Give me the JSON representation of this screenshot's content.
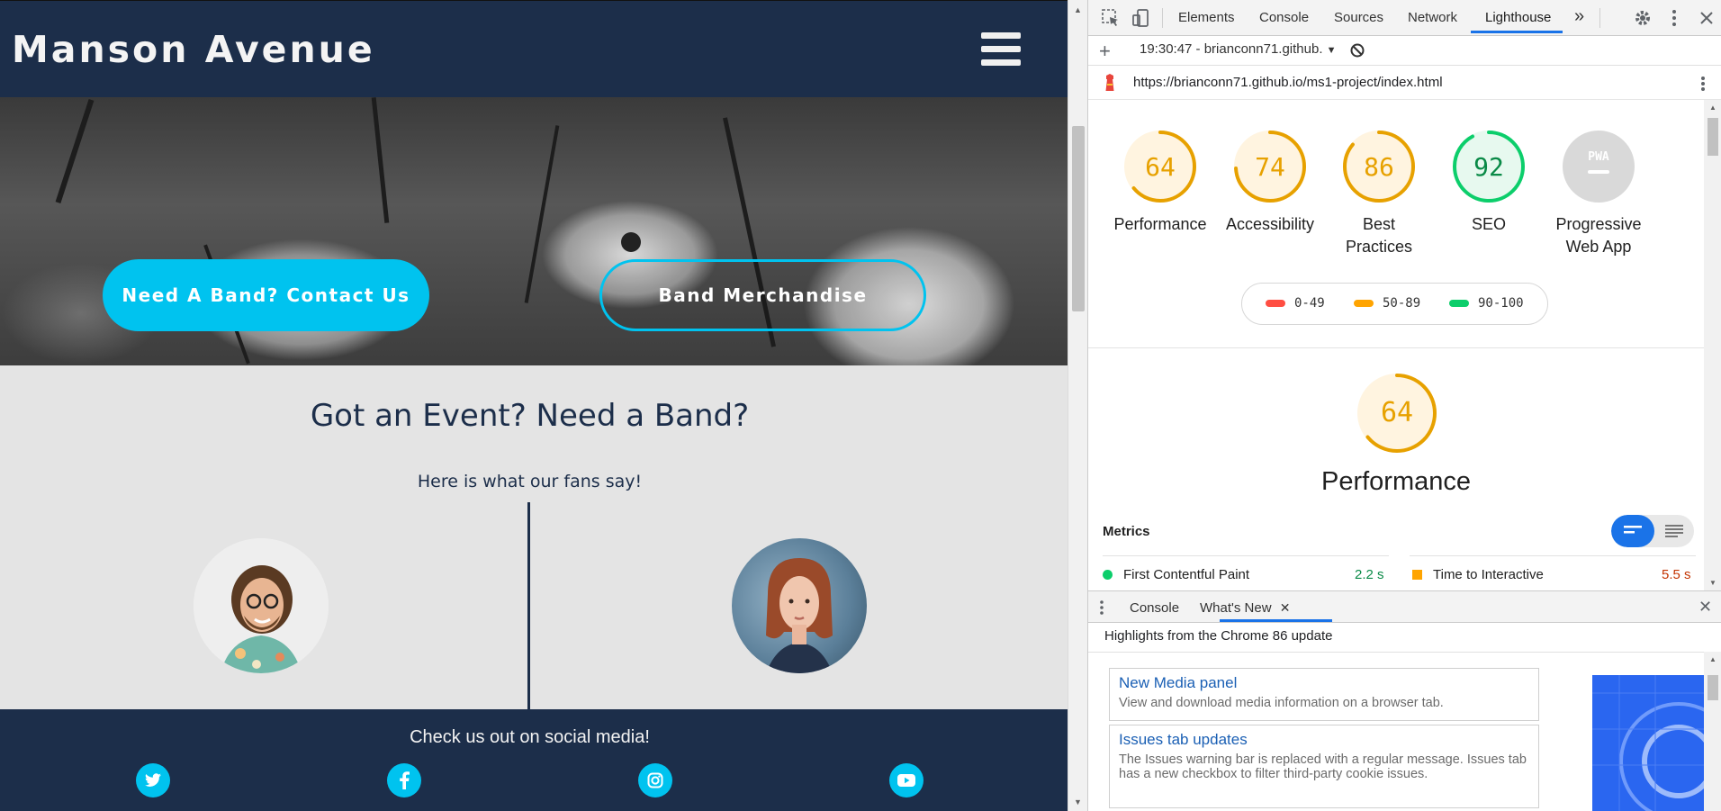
{
  "site": {
    "brand": "Manson Avenue",
    "hero": {
      "contact_button": "Need A Band? Contact Us",
      "merch_button": "Band Merchandise"
    },
    "event": {
      "title": "Got an Event? Need a Band?",
      "subtitle": "Here is what our fans say!"
    },
    "social": {
      "title": "Check us out on social media!",
      "icons": [
        "twitter-icon",
        "facebook-icon",
        "instagram-icon",
        "youtube-icon"
      ]
    }
  },
  "devtools": {
    "tabs": [
      "Elements",
      "Console",
      "Sources",
      "Network",
      "Lighthouse"
    ],
    "active_tab": "Lighthouse",
    "more_tabs": "»",
    "report_select": "19:30:47 - brianconn71.github.",
    "url": "https://brianconn71.github.io/ms1-project/index.html",
    "scores": [
      {
        "label": "Performance",
        "value": "64",
        "color": "#e7a100",
        "fill": 0.64
      },
      {
        "label": "Accessibility",
        "value": "74",
        "color": "#e7a100",
        "fill": 0.74
      },
      {
        "label": "Best Practices",
        "value": "86",
        "color": "#e7a100",
        "fill": 0.86
      },
      {
        "label": "SEO",
        "value": "92",
        "color": "#0cce6b",
        "fill": 0.92
      },
      {
        "label": "Progressive Web App",
        "value": "PWA",
        "color": "#c6c6c6",
        "fill": 0
      }
    ],
    "legend": [
      {
        "range": "0-49",
        "color": "#ff4e42"
      },
      {
        "range": "50-89",
        "color": "#ffa400"
      },
      {
        "range": "90-100",
        "color": "#0cce6b"
      }
    ],
    "performance": {
      "score": "64",
      "title": "Performance",
      "metrics_title": "Metrics",
      "metrics": [
        {
          "name": "First Contentful Paint",
          "value": "2.2 s",
          "status_color": "#0cce6b",
          "value_color": "#0a8a47"
        },
        {
          "name": "Time to Interactive",
          "value": "5.5 s",
          "status_color": "#ffa400",
          "value_color": "#c33300"
        }
      ]
    },
    "drawer": {
      "tabs": [
        "Console",
        "What's New"
      ],
      "active_tab": "What's New",
      "heading": "Highlights from the Chrome 86 update",
      "items": [
        {
          "title": "New Media panel",
          "desc": "View and download media information on a browser tab."
        },
        {
          "title": "Issues tab updates",
          "desc": "The Issues warning bar is replaced with a regular message. Issues tab has a new checkbox to filter third-party cookie issues."
        }
      ]
    }
  }
}
